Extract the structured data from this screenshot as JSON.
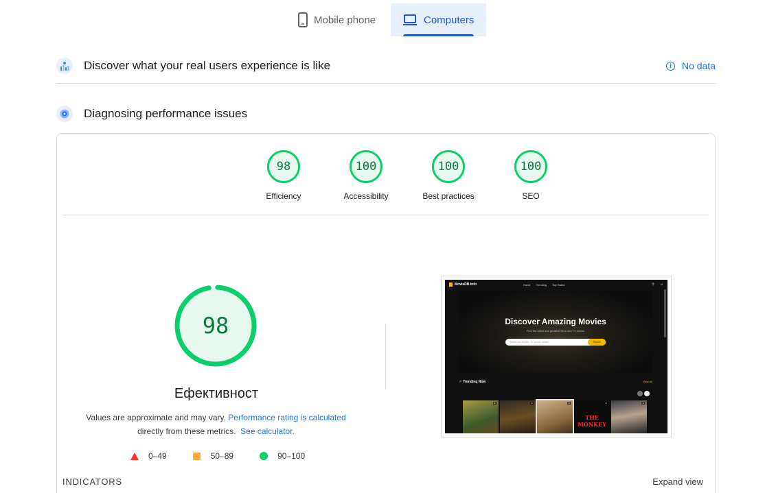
{
  "tabs": [
    {
      "label": "Mobile phone",
      "icon": "smartphone-icon",
      "active": false
    },
    {
      "label": "Computers",
      "icon": "laptop-icon",
      "active": true
    }
  ],
  "field_section": {
    "title": "Discover what your real users experience is like",
    "status_label": "No data"
  },
  "lab_section": {
    "title": "Diagnosing performance issues"
  },
  "categories": [
    {
      "label": "Efficiency",
      "score": "98"
    },
    {
      "label": "Accessibility",
      "score": "100"
    },
    {
      "label": "Best practices",
      "score": "100"
    },
    {
      "label": "SEO",
      "score": "100"
    }
  ],
  "main_score": {
    "score": "98",
    "score_fraction": 0.98,
    "title": "Ефективност",
    "note_prefix": "Values are approximate and may vary.",
    "note_link": "Performance rating is calculated",
    "note_middle": "directly from these metrics.",
    "note_calc_link": "See calculator."
  },
  "legend": [
    {
      "range": "0–49",
      "shape": "triangle",
      "color": "#ff3333"
    },
    {
      "range": "50–89",
      "shape": "square",
      "color": "#ffaa33"
    },
    {
      "range": "90–100",
      "shape": "circle",
      "color": "#0cce6b"
    }
  ],
  "indicators_label": "INDICATORS",
  "expand_label": "Expand view",
  "thumbnail": {
    "site_name": "MovieDB Info",
    "nav_links": [
      "Home",
      "Trending",
      "Top Rated"
    ],
    "hero_title": "Discover Amazing Movies",
    "hero_subtitle": "Find the latest and greatest films and TV shows",
    "search_placeholder": "Search for movies, TV shows, actors...",
    "search_button": "Search",
    "section_title": "Trending Now",
    "view_all": "View All",
    "poster_text": "THE MONKEY"
  },
  "colors": {
    "accent": "#1a73e8",
    "pass": "#0cce6b",
    "pass_text": "#0a7a3f"
  }
}
